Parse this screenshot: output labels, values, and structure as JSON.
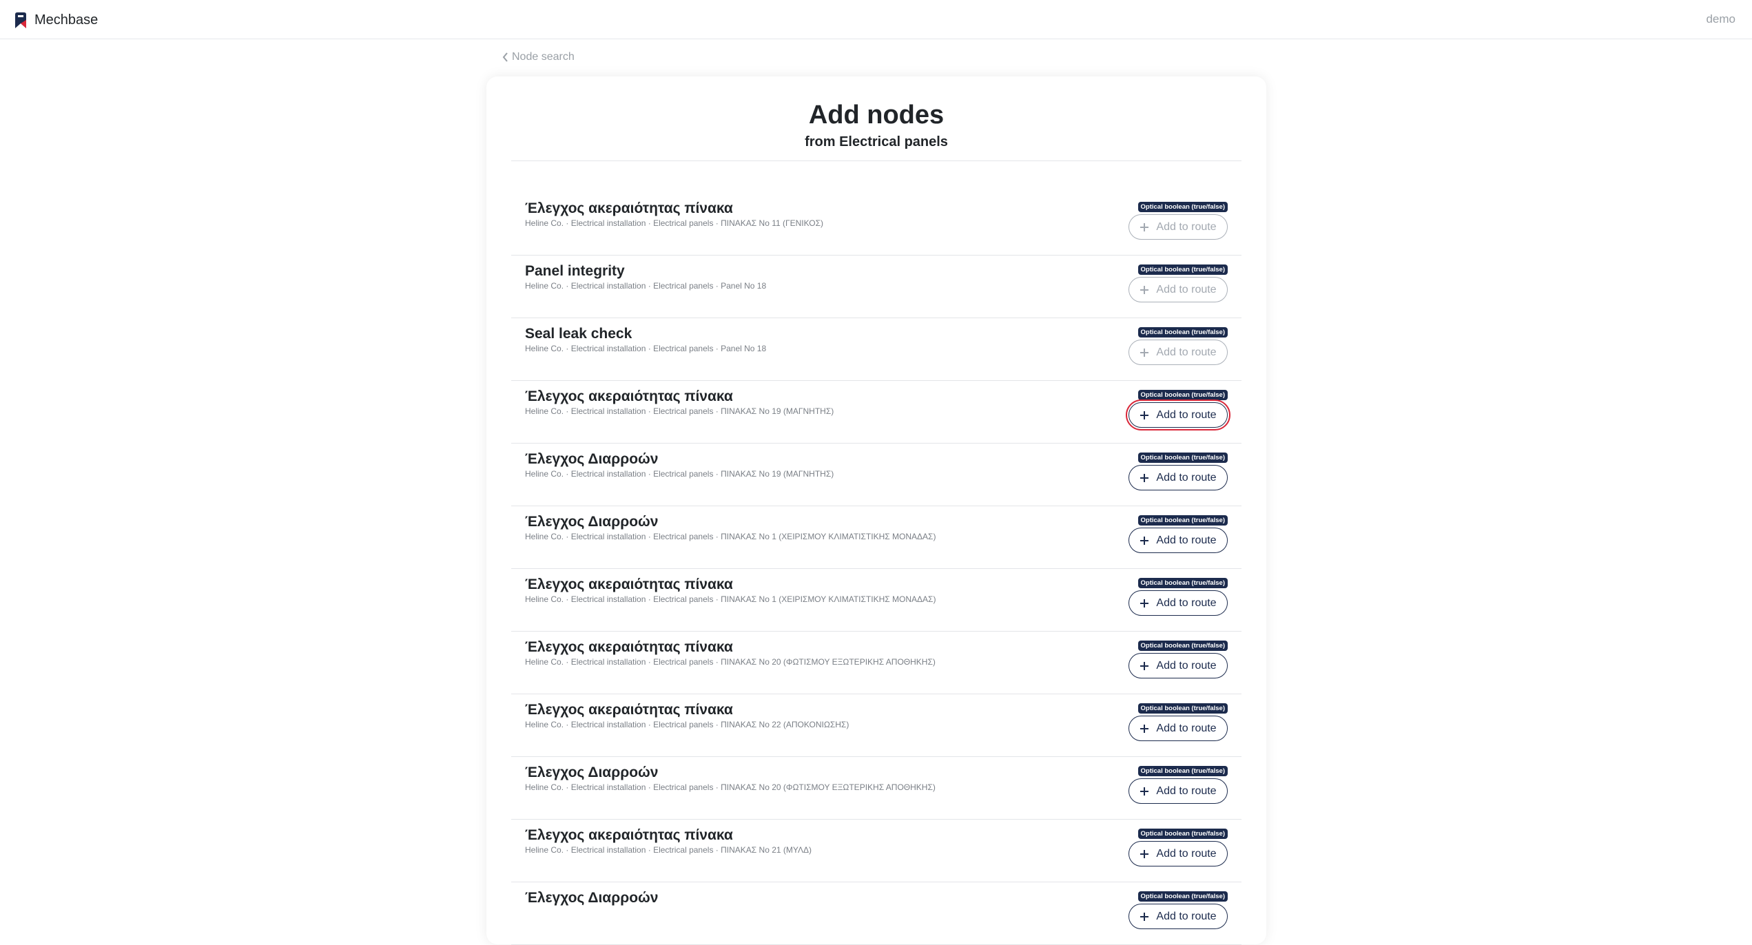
{
  "topbar": {
    "brand": "Mechbase",
    "user": "demo"
  },
  "back_link": "Node search",
  "header": {
    "title": "Add nodes",
    "subtitle": "from Electrical panels"
  },
  "colors": {
    "primary": "#1c2b4d",
    "highlight": "#d9283a",
    "disabled": "#a3a9b1"
  },
  "nodes": [
    {
      "title": "Έλεγχος ακεραιότητας πίνακα",
      "path": "Heline Co. · Electrical installation · Electrical panels · ΠΙΝΑΚΑΣ Νο 11 (ΓΕΝΙΚΟΣ)",
      "badge": "Optical boolean (true/false)",
      "button": "Add to route",
      "state": "disabled"
    },
    {
      "title": "Panel integrity",
      "path": "Heline Co. · Electrical installation · Electrical panels · Panel No 18",
      "badge": "Optical boolean (true/false)",
      "button": "Add to route",
      "state": "disabled"
    },
    {
      "title": "Seal leak check",
      "path": "Heline Co. · Electrical installation · Electrical panels · Panel No 18",
      "badge": "Optical boolean (true/false)",
      "button": "Add to route",
      "state": "disabled"
    },
    {
      "title": "Έλεγχος ακεραιότητας πίνακα",
      "path": "Heline Co. · Electrical installation · Electrical panels · ΠΙΝΑΚΑΣ Νο 19 (ΜΑΓΝΗΤΗΣ)",
      "badge": "Optical boolean (true/false)",
      "button": "Add to route",
      "state": "highlight"
    },
    {
      "title": "Έλεγχος Διαρροών",
      "path": "Heline Co. · Electrical installation · Electrical panels · ΠΙΝΑΚΑΣ Νο 19 (ΜΑΓΝΗΤΗΣ)",
      "badge": "Optical boolean (true/false)",
      "button": "Add to route",
      "state": "active"
    },
    {
      "title": "Έλεγχος Διαρροών",
      "path": "Heline Co. · Electrical installation · Electrical panels · ΠΙΝΑΚΑΣ Νο 1 (ΧΕΙΡΙΣΜΟΥ ΚΛΙΜΑΤΙΣΤΙΚΗΣ ΜΟΝΑΔΑΣ)",
      "badge": "Optical boolean (true/false)",
      "button": "Add to route",
      "state": "active"
    },
    {
      "title": "Έλεγχος ακεραιότητας πίνακα",
      "path": "Heline Co. · Electrical installation · Electrical panels · ΠΙΝΑΚΑΣ Νο 1 (ΧΕΙΡΙΣΜΟΥ ΚΛΙΜΑΤΙΣΤΙΚΗΣ ΜΟΝΑΔΑΣ)",
      "badge": "Optical boolean (true/false)",
      "button": "Add to route",
      "state": "active"
    },
    {
      "title": "Έλεγχος ακεραιότητας πίνακα",
      "path": "Heline Co. · Electrical installation · Electrical panels · ΠΙΝΑΚΑΣ Νο 20 (ΦΩΤΙΣΜΟΥ ΕΞΩΤΕΡΙΚΗΣ ΑΠΟΘΗΚΗΣ)",
      "badge": "Optical boolean (true/false)",
      "button": "Add to route",
      "state": "active"
    },
    {
      "title": "Έλεγχος ακεραιότητας πίνακα",
      "path": "Heline Co. · Electrical installation · Electrical panels · ΠΙΝΑΚΑΣ Νο 22 (ΑΠΟΚΟΝΙΩΣΗΣ)",
      "badge": "Optical boolean (true/false)",
      "button": "Add to route",
      "state": "active"
    },
    {
      "title": "Έλεγχος Διαρροών",
      "path": "Heline Co. · Electrical installation · Electrical panels · ΠΙΝΑΚΑΣ Νο 20 (ΦΩΤΙΣΜΟΥ ΕΞΩΤΕΡΙΚΗΣ ΑΠΟΘΗΚΗΣ)",
      "badge": "Optical boolean (true/false)",
      "button": "Add to route",
      "state": "active"
    },
    {
      "title": "Έλεγχος ακεραιότητας πίνακα",
      "path": "Heline Co. · Electrical installation · Electrical panels · ΠΙΝΑΚΑΣ Νο 21 (ΜΥΛΔ)",
      "badge": "Optical boolean (true/false)",
      "button": "Add to route",
      "state": "active"
    },
    {
      "title": "Έλεγχος Διαρροών",
      "path": "",
      "badge": "Optical boolean (true/false)",
      "button": "Add to route",
      "state": "active"
    }
  ]
}
